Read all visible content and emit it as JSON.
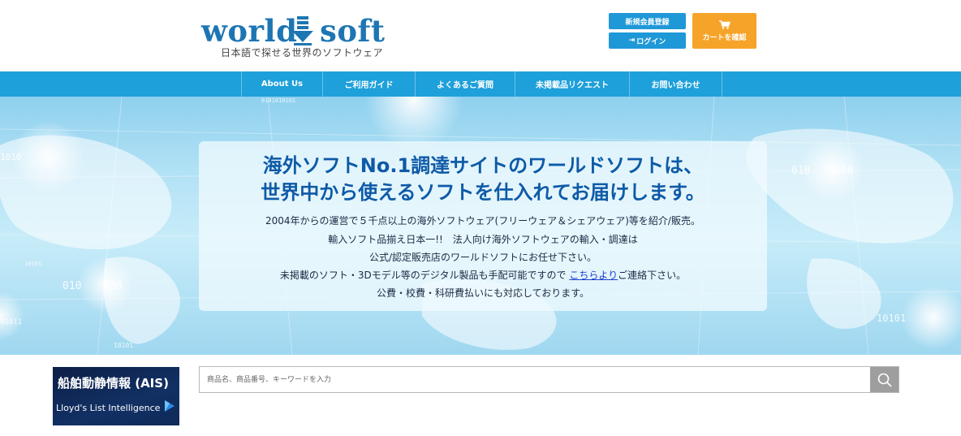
{
  "header": {
    "logo_word_left": "world",
    "logo_word_right": "soft",
    "logo_tagline": "日本語で探せる世界のソフトウェア",
    "register_label": "新規会員登録",
    "login_label": "ログイン",
    "cart_label": "カートを確認",
    "brand_color": "#1d76b3",
    "accent_orange": "#f6a429"
  },
  "nav": {
    "items": [
      {
        "label": "About Us"
      },
      {
        "label": "ご利用ガイド"
      },
      {
        "label": "よくあるご質問"
      },
      {
        "label": "未掲載品リクエスト"
      },
      {
        "label": "お問い合わせ"
      }
    ],
    "bar_color": "#1ea0da"
  },
  "hero": {
    "title_line1": "海外ソフトNo.1調達サイトのワールドソフトは、",
    "title_line2": "世界中から使えるソフトを仕入れてお届けします。",
    "line1": "2004年からの運営で５千点以上の海外ソフトウェア(フリーウェア＆シェアウェア)等を紹介/販売。",
    "line2": "輸入ソフト品揃え日本一!!　法人向け海外ソフトウェアの輸入・調達は",
    "line3": "公式/認定販売店のワールドソフトにお任せ下さい。",
    "line4_before": "未掲載のソフト・3Dモデル等のデジタル製品も手配可能ですので ",
    "line4_link": "こちらより",
    "line4_after": "ご連絡下さい。",
    "line5": "公費・校費・科研費払いにも対応しております。",
    "bg_digits_a": "0101010101",
    "bg_digits_b": "010",
    "bg_digits_c": "100",
    "bg_digits_d": "1010",
    "bg_digits_e": "10101",
    "bg_digits_f": "01011"
  },
  "banner": {
    "title": "船舶動静情報 (AIS)",
    "subtitle": "Lloyd's List Intelligence"
  },
  "search": {
    "placeholder": "商品名、商品番号、キーワードを入力"
  }
}
